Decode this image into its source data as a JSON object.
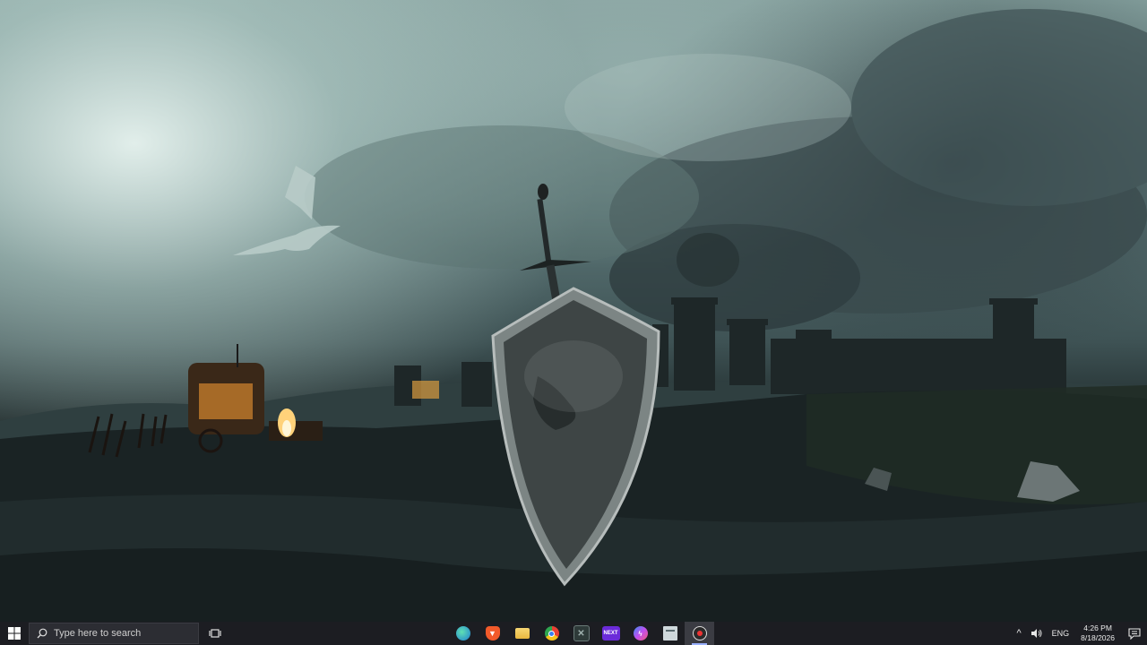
{
  "wallpaper": {
    "description_icons": [
      "dragon-icon",
      "sword-icon",
      "shield-icon",
      "castle-icon",
      "wagon-icon",
      "campfire-icon"
    ]
  },
  "taskbar": {
    "search_placeholder": "Type here to search",
    "apps": [
      {
        "name": "edge",
        "icon": "edge-icon",
        "color": "#2a8fd6",
        "label": ""
      },
      {
        "name": "brave",
        "icon": "brave-icon",
        "color": "#f25a2a",
        "label": ""
      },
      {
        "name": "file-explorer",
        "icon": "folder-icon",
        "color": "#f2c14e",
        "label": ""
      },
      {
        "name": "chrome",
        "icon": "chrome-icon",
        "color": "#e84134",
        "label": ""
      },
      {
        "name": "app-x",
        "icon": "x-box-icon",
        "color": "#3a4a48",
        "label": ""
      },
      {
        "name": "next",
        "icon": "next-icon",
        "color": "#6b2bd9",
        "label": "NEXT"
      },
      {
        "name": "messenger",
        "icon": "messenger-icon",
        "color": "#7b4ef0",
        "label": ""
      },
      {
        "name": "window-app",
        "icon": "window-icon",
        "color": "#cfd8dc",
        "label": ""
      },
      {
        "name": "obs",
        "icon": "record-icon",
        "color": "#2b2b2b",
        "label": ""
      }
    ],
    "tray": {
      "chevron": "^",
      "language": "ENG",
      "time": "4:26 PM",
      "date": "8/18/2026"
    }
  }
}
